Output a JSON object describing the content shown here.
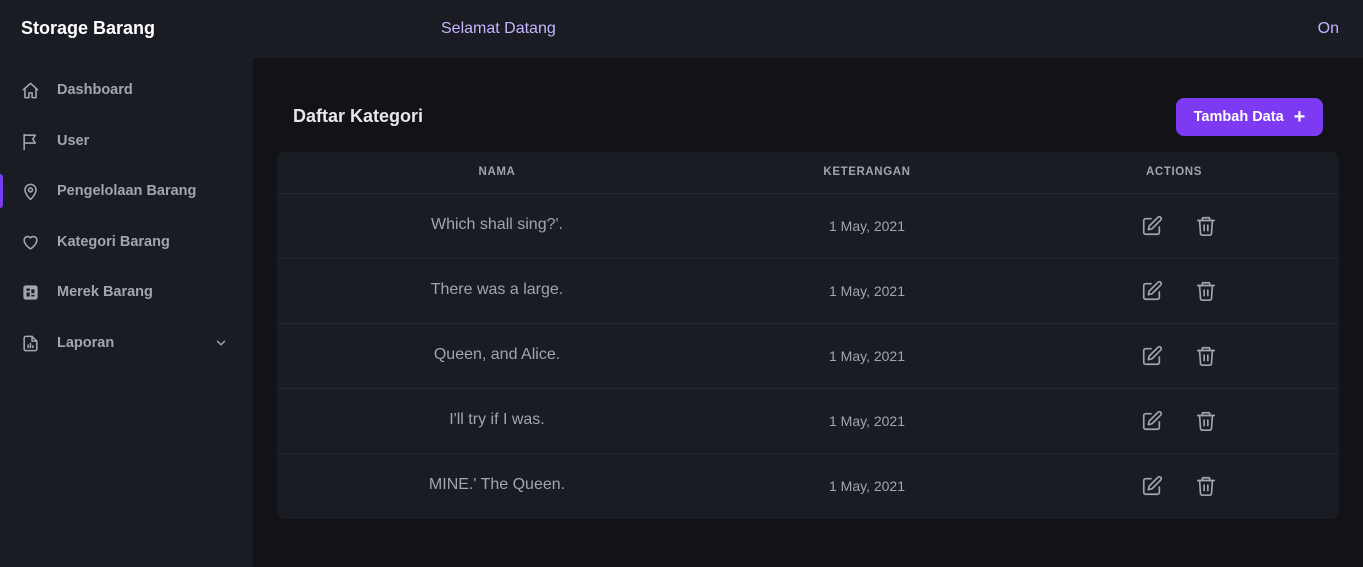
{
  "header": {
    "brand": "Storage Barang",
    "welcome": "Selamat Datang",
    "toggle_label": "On"
  },
  "sidebar": {
    "items": [
      {
        "label": "Dashboard",
        "icon": "home-icon"
      },
      {
        "label": "User",
        "icon": "flag-icon"
      },
      {
        "label": "Pengelolaan Barang",
        "icon": "map-pin-icon",
        "active": true
      },
      {
        "label": "Kategori Barang",
        "icon": "heart-icon"
      },
      {
        "label": "Merek Barang",
        "icon": "pattern-icon"
      },
      {
        "label": "Laporan",
        "icon": "report-icon",
        "has_submenu": true
      }
    ]
  },
  "main": {
    "title": "Daftar Kategori",
    "add_button_label": "Tambah Data",
    "add_button_icon": "plus-icon",
    "accent_color": "#7e3af2",
    "table": {
      "headers": [
        "NAMA",
        "KETERANGAN",
        "ACTIONS"
      ],
      "rows": [
        {
          "nama": "Which shall sing?'.",
          "keterangan": "1 May, 2021"
        },
        {
          "nama": "There was a large.",
          "keterangan": "1 May, 2021"
        },
        {
          "nama": "Queen, and Alice.",
          "keterangan": "1 May, 2021"
        },
        {
          "nama": "I'll try if I was.",
          "keterangan": "1 May, 2021"
        },
        {
          "nama": "MINE.' The Queen.",
          "keterangan": "1 May, 2021"
        }
      ],
      "row_actions": [
        "edit-icon",
        "trash-icon"
      ]
    }
  }
}
